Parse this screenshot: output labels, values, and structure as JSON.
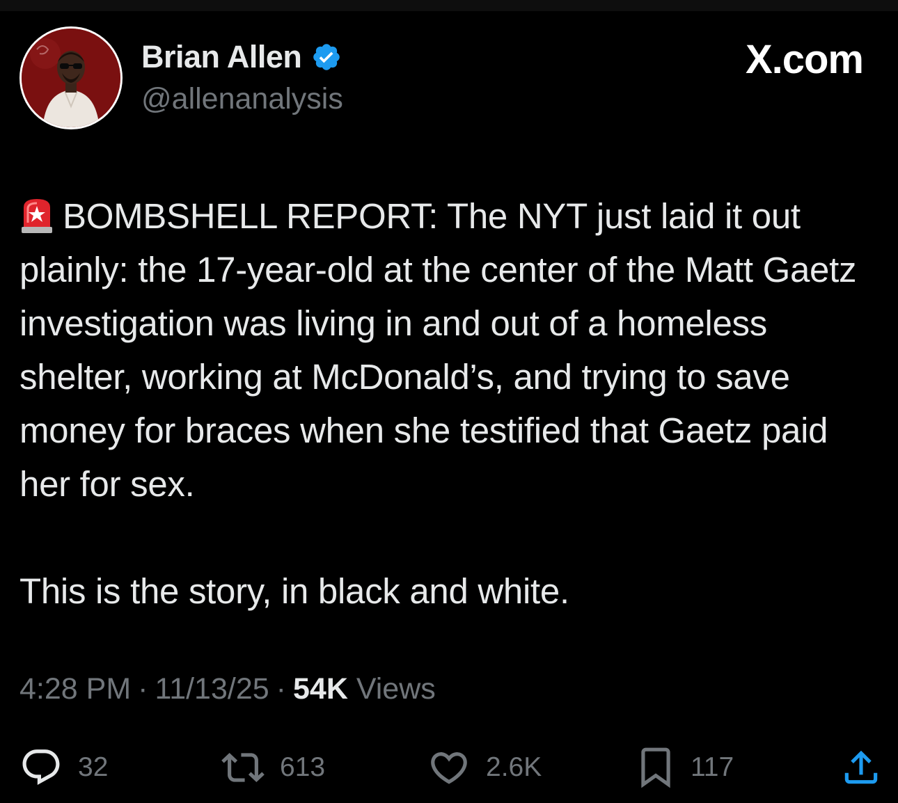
{
  "author": {
    "name": "Brian Allen",
    "handle": "@allenanalysis",
    "verified": true
  },
  "site_label": "X.com",
  "tweet": {
    "paragraph_1": "BOMBSHELL REPORT: The NYT just laid it out plainly: the 17-year-old at the center of the Matt Gaetz investigation was living in and out of a homeless shelter, working at McDonald’s, and trying to save money for braces when she testified that Gaetz paid her for sex.",
    "paragraph_2": "This is the story, in black and white.",
    "leading_emoji": "police-car-light-icon"
  },
  "meta": {
    "time": "4:28 PM",
    "separator": "·",
    "date": "11/13/25",
    "views_count": "54K",
    "views_label": "Views"
  },
  "actions": {
    "replies": "32",
    "reposts": "613",
    "likes": "2.6K",
    "bookmarks": "117"
  },
  "colors": {
    "background": "#000000",
    "text": "#e7e9ea",
    "secondary": "#71767b",
    "verified": "#1d9bf0"
  }
}
